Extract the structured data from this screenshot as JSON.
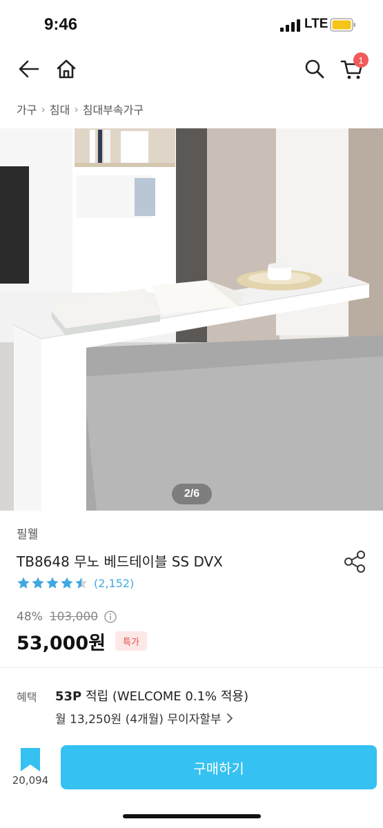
{
  "status": {
    "time": "9:46",
    "network": "LTE"
  },
  "nav": {
    "cart_count": "1"
  },
  "breadcrumb": [
    "가구",
    "침대",
    "침대부속가구"
  ],
  "image": {
    "pager": "2/6"
  },
  "product": {
    "brand": "필웰",
    "title": "TB8648 무노 베드테이블 SS DVX",
    "rating": 4.5,
    "review_count": "(2,152)",
    "discount": "48%",
    "original_price": "103,000",
    "price": "53,000원",
    "badge": "특가"
  },
  "benefit": {
    "label": "혜택",
    "points": "53P",
    "points_text": " 적립 (WELCOME 0.1% 적용)",
    "installment": "월 13,250원 (4개월) 무이자할부"
  },
  "bottom": {
    "wish_count": "20,094",
    "buy_label": "구매하기"
  },
  "colors": {
    "accent": "#35c1f1",
    "star": "#3fa9e0",
    "badge_bg": "#fde8e8",
    "badge_text": "#e84a4a",
    "cart_badge": "#f05a5a"
  },
  "icons": [
    "back-arrow-icon",
    "home-icon",
    "search-icon",
    "cart-icon",
    "share-icon",
    "info-icon",
    "bookmark-icon",
    "chevron-right-icon"
  ]
}
